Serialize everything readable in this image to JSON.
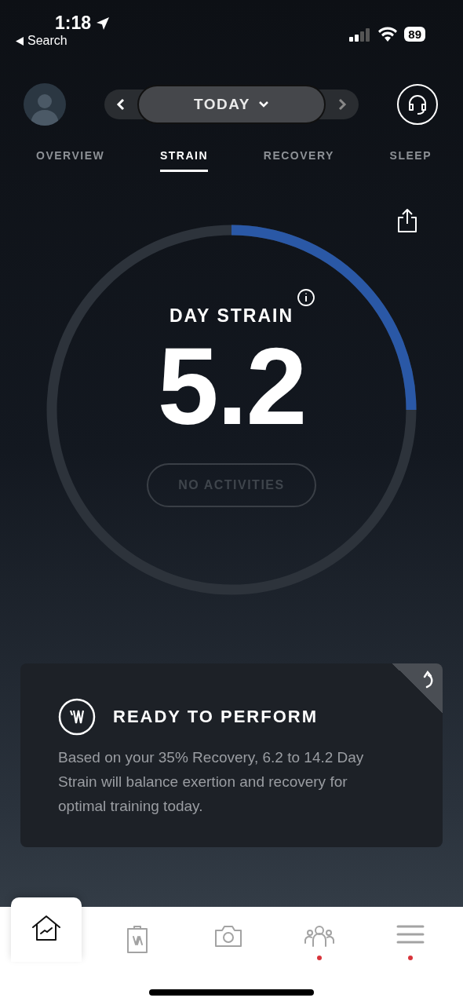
{
  "status_bar": {
    "time": "1:18",
    "back_label": "Search",
    "battery": "89"
  },
  "date_nav": {
    "label": "TODAY"
  },
  "tabs": [
    {
      "label": "OVERVIEW",
      "selected": false
    },
    {
      "label": "STRAIN",
      "selected": true
    },
    {
      "label": "RECOVERY",
      "selected": false
    },
    {
      "label": "SLEEP",
      "selected": false
    }
  ],
  "gauge": {
    "title": "DAY STRAIN",
    "value": "5.2",
    "activities_button": "NO ACTIVITIES"
  },
  "card": {
    "title": "READY TO PERFORM",
    "body": "Based on your 35% Recovery, 6.2 to 14.2 Day Strain will balance exertion and recovery for optimal training today."
  },
  "bottom_nav": [
    {
      "kind": "home",
      "selected": true,
      "badge": false
    },
    {
      "kind": "clipboard",
      "selected": false,
      "badge": false
    },
    {
      "kind": "camera",
      "selected": false,
      "badge": false
    },
    {
      "kind": "team",
      "selected": false,
      "badge": true
    },
    {
      "kind": "menu",
      "selected": false,
      "badge": true
    }
  ]
}
